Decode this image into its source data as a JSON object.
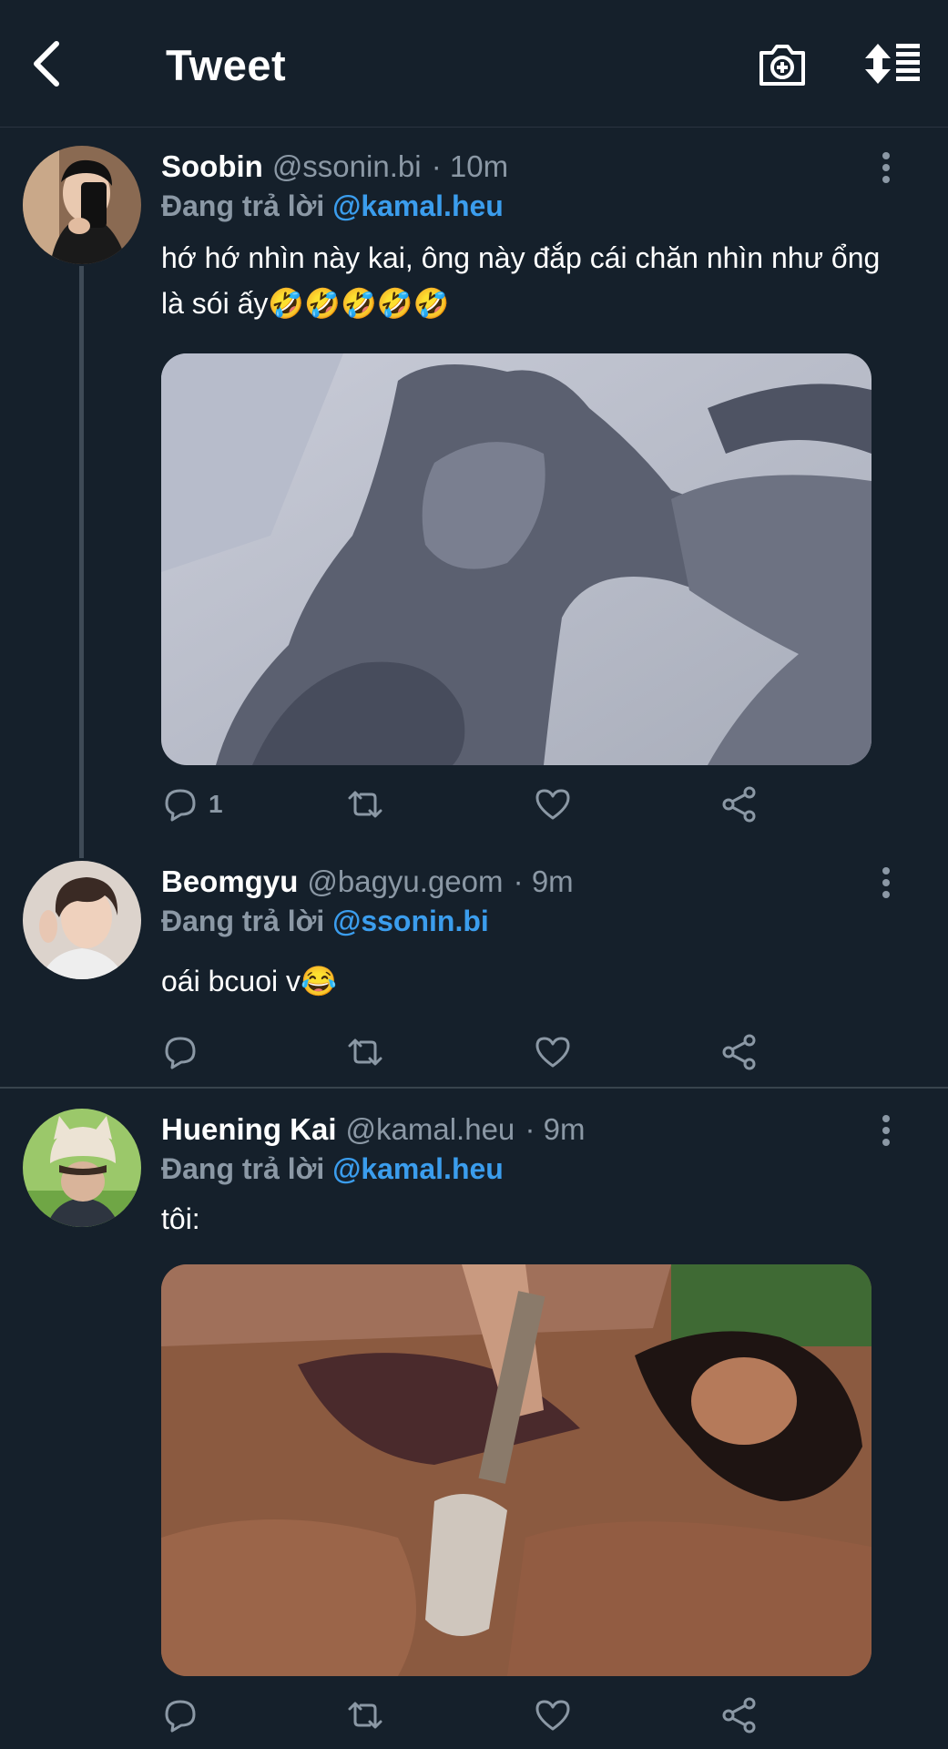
{
  "header": {
    "title": "Tweet"
  },
  "tweets": [
    {
      "name": "Soobin",
      "handle": "@ssonin.bi",
      "time": "· 10m",
      "reply_prefix": "Đang trả lời",
      "reply_to": "@kamal.heu",
      "text": "hớ hớ nhìn này kai, ông này đắp cái chăn nhìn như ổng là sói ấy🤣🤣🤣🤣🤣",
      "reply_count": "1"
    },
    {
      "name": "Beomgyu",
      "handle": "@bagyu.geom",
      "time": "· 9m",
      "reply_prefix": "Đang trả lời",
      "reply_to": "@ssonin.bi",
      "text": "oái bcuoi v😂",
      "reply_count": ""
    },
    {
      "name": "Huening Kai",
      "handle": "@kamal.heu",
      "time": "· 9m",
      "reply_prefix": "Đang trả lời",
      "reply_to": "@kamal.heu",
      "text": "tôi:",
      "reply_count": ""
    }
  ],
  "icons": {
    "back": "chevron-left-icon",
    "camera": "camera-plus-icon",
    "sort": "sort-icon",
    "reply": "reply-icon",
    "retweet": "retweet-icon",
    "like": "heart-icon",
    "share": "share-icon",
    "more": "more-vertical-icon"
  },
  "colors": {
    "background": "#15202b",
    "mention": "#3b9ded",
    "muted": "#8b98a5",
    "divider": "#38444d"
  }
}
